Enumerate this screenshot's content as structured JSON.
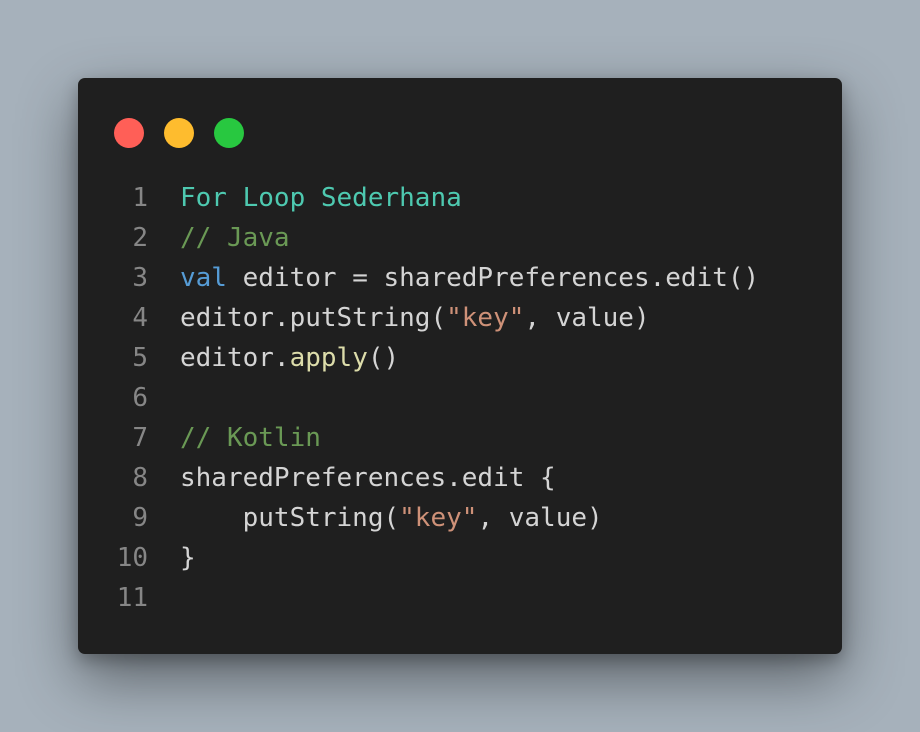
{
  "colors": {
    "background": "#a6b1bb",
    "editor_bg": "#1f1f1f",
    "dot_close": "#ff5f57",
    "dot_minimize": "#febc2e",
    "dot_maximize": "#28c840",
    "keyword": "#569cd6",
    "string": "#ce9178",
    "comment": "#6a9955",
    "function": "#dcdcaa",
    "title": "#4ec9b0",
    "text": "#d4d4d4",
    "line_number": "#868686"
  },
  "lines": [
    {
      "number": "1",
      "tokens": [
        {
          "text": "For Loop Sederhana",
          "kind": "title"
        }
      ]
    },
    {
      "number": "2",
      "tokens": [
        {
          "text": "// Java",
          "kind": "comment"
        }
      ]
    },
    {
      "number": "3",
      "tokens": [
        {
          "text": "val",
          "kind": "kw"
        },
        {
          "text": " editor = sharedPreferences.edit()",
          "kind": "plain"
        }
      ]
    },
    {
      "number": "4",
      "tokens": [
        {
          "text": "editor.putString(",
          "kind": "plain"
        },
        {
          "text": "\"key\"",
          "kind": "str"
        },
        {
          "text": ", value)",
          "kind": "plain"
        }
      ]
    },
    {
      "number": "5",
      "tokens": [
        {
          "text": "editor.",
          "kind": "plain"
        },
        {
          "text": "apply",
          "kind": "fn"
        },
        {
          "text": "()",
          "kind": "plain"
        }
      ]
    },
    {
      "number": "6",
      "tokens": []
    },
    {
      "number": "7",
      "tokens": [
        {
          "text": "// Kotlin",
          "kind": "comment"
        }
      ]
    },
    {
      "number": "8",
      "tokens": [
        {
          "text": "sharedPreferences.edit {",
          "kind": "plain"
        }
      ]
    },
    {
      "number": "9",
      "tokens": [
        {
          "text": "    putString(",
          "kind": "plain"
        },
        {
          "text": "\"key\"",
          "kind": "str"
        },
        {
          "text": ", value)",
          "kind": "plain"
        }
      ]
    },
    {
      "number": "10",
      "tokens": [
        {
          "text": "}",
          "kind": "plain"
        }
      ]
    },
    {
      "number": "11",
      "tokens": []
    }
  ]
}
